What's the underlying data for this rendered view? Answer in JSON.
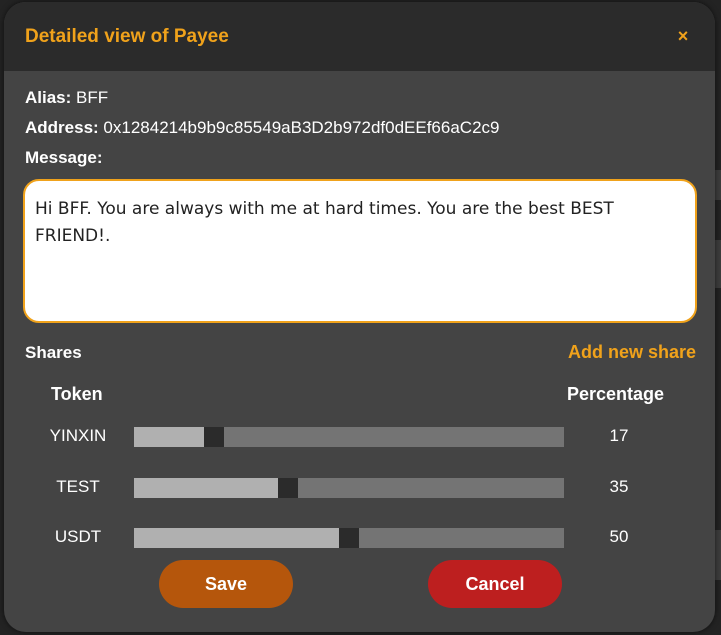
{
  "modal": {
    "title": "Detailed view of Payee",
    "close_glyph": "×"
  },
  "payee": {
    "alias_label": "Alias:",
    "alias": "BFF",
    "address_label": "Address:",
    "address": "0x1284214b9b9c85549aB3D2b972df0dEEf66aC2c9",
    "message_label": "Message:",
    "message": "Hi BFF. You are always with me at hard times. You are the best BEST FRIEND!."
  },
  "shares": {
    "title": "Shares",
    "add_label": "Add new share",
    "col_token": "Token",
    "col_percentage": "Percentage",
    "rows": [
      {
        "token": "YINXIN",
        "percentage": "17",
        "value": 17
      },
      {
        "token": "TEST",
        "percentage": "35",
        "value": 35
      },
      {
        "token": "USDT",
        "percentage": "50",
        "value": 50
      }
    ]
  },
  "actions": {
    "save_label": "Save",
    "cancel_label": "Cancel"
  },
  "colors": {
    "accent": "#f0a21b",
    "save": "#b5560c",
    "cancel": "#bd1f1f"
  }
}
